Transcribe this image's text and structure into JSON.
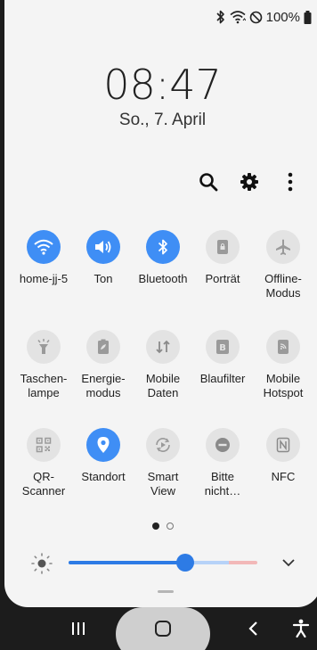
{
  "status_bar": {
    "battery_text": "100%",
    "icons": [
      "bluetooth-icon",
      "wifi-icon",
      "do-not-disturb-icon",
      "battery-icon"
    ]
  },
  "clock": {
    "time": "08:47",
    "date": "So., 7. April"
  },
  "toolbar": {
    "icons": [
      "search-icon",
      "gear-icon",
      "more-vert-icon"
    ]
  },
  "colors": {
    "accent": "#3f8ef5",
    "inactive_tile": "#e3e3e3",
    "panel_bg": "#f4f4f4",
    "nav_bg": "#1c1c1c"
  },
  "tiles": [
    {
      "id": "wifi",
      "label": "home-jj-5",
      "on": true,
      "icon": "wifi-icon"
    },
    {
      "id": "sound",
      "label": "Ton",
      "on": true,
      "icon": "speaker-icon"
    },
    {
      "id": "bluetooth",
      "label": "Bluetooth",
      "on": true,
      "icon": "bluetooth-icon"
    },
    {
      "id": "portrait",
      "label": "Porträt",
      "on": false,
      "icon": "portrait-lock-icon"
    },
    {
      "id": "offline",
      "label": "Offline-\nModus",
      "on": false,
      "icon": "airplane-icon"
    },
    {
      "id": "flashlight",
      "label": "Taschen-\nlampe",
      "on": false,
      "icon": "flashlight-icon"
    },
    {
      "id": "power",
      "label": "Energie-\nmodus",
      "on": false,
      "icon": "battery-saver-icon"
    },
    {
      "id": "mobile-data",
      "label": "Mobile\nDaten",
      "on": false,
      "icon": "data-arrows-icon"
    },
    {
      "id": "bluefilter",
      "label": "Blaufilter",
      "on": false,
      "icon": "blue-light-filter-icon"
    },
    {
      "id": "hotspot",
      "label": "Mobile\nHotspot",
      "on": false,
      "icon": "hotspot-icon"
    },
    {
      "id": "qr",
      "label": "QR-\nScanner",
      "on": false,
      "icon": "qr-code-icon"
    },
    {
      "id": "location",
      "label": "Standort",
      "on": true,
      "icon": "location-pin-icon"
    },
    {
      "id": "smartview",
      "label": "Smart\nView",
      "on": false,
      "icon": "smart-view-icon"
    },
    {
      "id": "dnd",
      "label": "Bitte\nnicht…",
      "on": false,
      "icon": "do-not-disturb-icon"
    },
    {
      "id": "nfc",
      "label": "NFC",
      "on": false,
      "icon": "nfc-icon"
    }
  ],
  "pager": {
    "pages": 2,
    "current": 1
  },
  "brightness": {
    "level": 0.62
  },
  "navbar": {
    "icons": [
      "recents-icon",
      "home-icon",
      "back-icon",
      "accessibility-icon"
    ]
  }
}
